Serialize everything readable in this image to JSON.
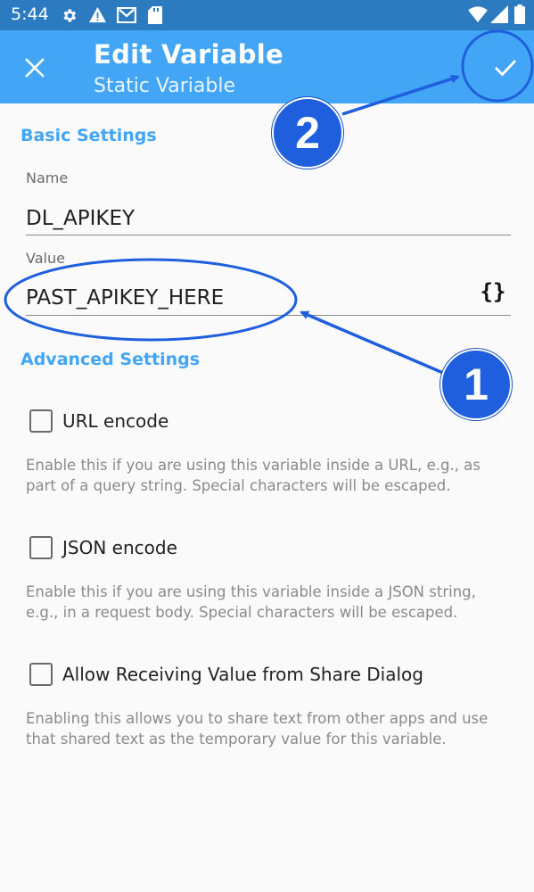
{
  "status_bar": {
    "time": "5:44",
    "icons": [
      "gear-icon",
      "warning-icon",
      "gmail-icon",
      "sd-card-icon",
      "wifi-icon",
      "signal-icon",
      "battery-icon"
    ]
  },
  "app_bar": {
    "title": "Edit Variable",
    "subtitle": "Static Variable",
    "close_icon": "close-icon",
    "confirm_icon": "check-icon",
    "color": "#42a5f5"
  },
  "basic_settings": {
    "header": "Basic Settings",
    "name_label": "Name",
    "name_value": "DL_APIKEY",
    "value_label": "Value",
    "value_value": "PAST_APIKEY_HERE",
    "variable_button_label": "{}"
  },
  "advanced_settings": {
    "header": "Advanced Settings",
    "options": [
      {
        "label": "URL encode",
        "checked": false,
        "description": "Enable this if you are using this variable inside a URL, e.g., as part of a query string. Special characters will be escaped."
      },
      {
        "label": "JSON encode",
        "checked": false,
        "description": "Enable this if you are using this variable inside a JSON string, e.g., in a request body. Special characters will be escaped."
      },
      {
        "label": "Allow Receiving Value from Share Dialog",
        "checked": false,
        "description": "Enabling this allows you to share text from other apps and use that shared text as the temporary value for this variable."
      }
    ]
  },
  "annotations": {
    "step_1": "1",
    "step_2": "2",
    "color": "#1f5fdd"
  }
}
